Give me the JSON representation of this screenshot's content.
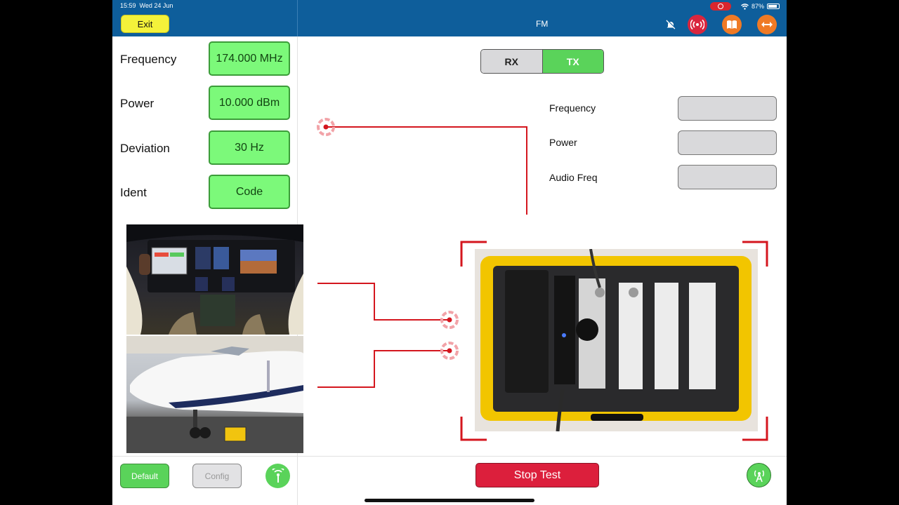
{
  "status_bar": {
    "time": "15:59",
    "date": "Wed 24 Jun",
    "battery": "87%"
  },
  "header": {
    "exit_label": "Exit",
    "title": "FM"
  },
  "params": [
    {
      "label": "Frequency",
      "value": "174.000 MHz"
    },
    {
      "label": "Power",
      "value": "10.000 dBm"
    },
    {
      "label": "Deviation",
      "value": "30 Hz"
    },
    {
      "label": "Ident",
      "value": "Code"
    }
  ],
  "mode": {
    "rx_label": "RX",
    "tx_label": "TX",
    "selected": "TX"
  },
  "measurements": [
    {
      "label": "Frequency",
      "value": ""
    },
    {
      "label": "Power",
      "value": ""
    },
    {
      "label": "Audio Freq",
      "value": ""
    }
  ],
  "footer": {
    "default_label": "Default",
    "config_label": "Config",
    "stop_label": "Stop Test"
  },
  "colors": {
    "nav_blue": "#0e5e9b",
    "accent_green": "#5ad35a",
    "stop_red": "#dc1f3c",
    "exit_yellow": "#f4f23a",
    "connector_red": "#d4161e"
  },
  "icons": [
    "mute-icon",
    "broadcast-icon",
    "book-icon",
    "resize-icon",
    "antenna-icon",
    "target-icon"
  ]
}
